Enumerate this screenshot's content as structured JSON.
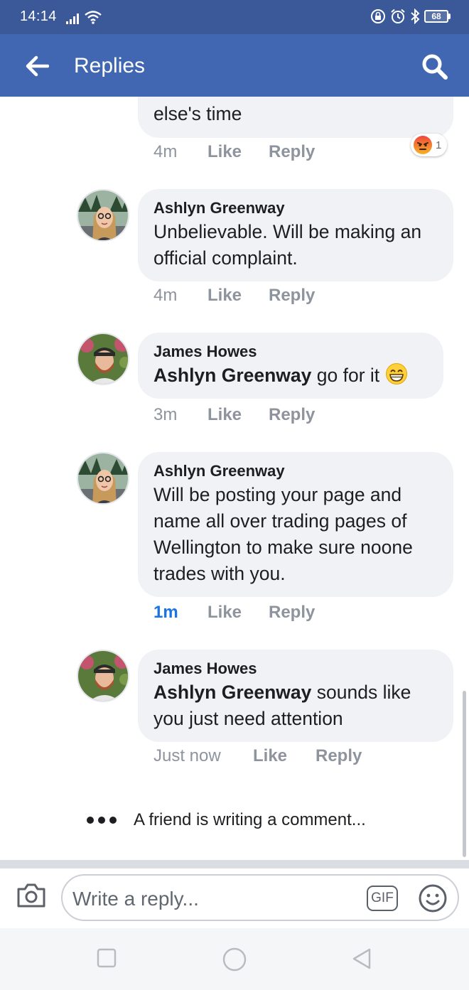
{
  "status_bar": {
    "time": "14:14",
    "battery": "68"
  },
  "header": {
    "title": "Replies"
  },
  "comments": [
    {
      "text": "else's time",
      "time": "4m",
      "like": "Like",
      "reply": "Reply",
      "reaction_count": "1"
    },
    {
      "author": "Ashlyn Greenway",
      "text": "Unbelievable. Will be making an official complaint.",
      "time": "4m",
      "like": "Like",
      "reply": "Reply"
    },
    {
      "author": "James Howes",
      "mention": "Ashlyn Greenway",
      "text": " go for it",
      "time": "3m",
      "like": "Like",
      "reply": "Reply"
    },
    {
      "author": "Ashlyn Greenway",
      "text": "Will be posting your page and name all over trading pages of Wellington to make sure noone trades with you.",
      "time": "1m",
      "like": "Like",
      "reply": "Reply"
    },
    {
      "author": "James Howes",
      "mention": "Ashlyn Greenway",
      "text": " sounds like you just need attention",
      "time": "Just now",
      "like": "Like",
      "reply": "Reply"
    }
  ],
  "typing_indicator": "A friend is writing a comment...",
  "composer": {
    "placeholder": "Write a reply...",
    "gif_label": "GIF"
  },
  "colors": {
    "status_bar": "#3b5998",
    "app_bar": "#4267b2",
    "bubble": "#f0f2f5",
    "meta_text": "#8d949e",
    "active_time": "#1b74e4"
  },
  "icons": {
    "back": "arrow-left-icon",
    "search": "search-icon",
    "camera": "camera-icon",
    "emoji": "smiley-icon",
    "reaction": "angry-reaction-icon",
    "grin": "grinning-emoji-icon"
  }
}
